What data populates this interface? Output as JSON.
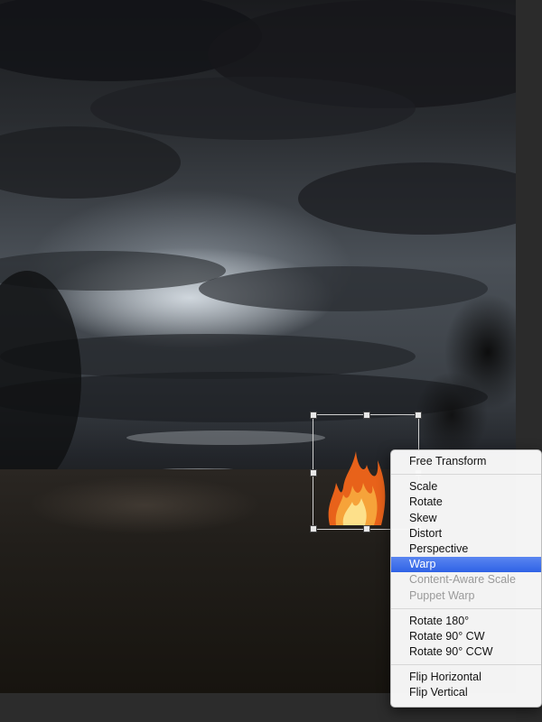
{
  "canvas": {
    "scene": "stormy sky over rocky ground with fire",
    "colors": {
      "sky_dark": "#1a1b1e",
      "sky_light": "#e1e8ee",
      "ground": "#211e1a",
      "fire": "#f08a1c",
      "selection_highlight": "#3b6ee8"
    }
  },
  "transform_box": {
    "handles": [
      "top-left",
      "top-center",
      "top-right",
      "middle-left",
      "middle-right",
      "bottom-left",
      "bottom-center",
      "bottom-right"
    ]
  },
  "context_menu": {
    "groups": [
      {
        "items": [
          {
            "label": "Free Transform",
            "enabled": true
          }
        ]
      },
      {
        "items": [
          {
            "label": "Scale",
            "enabled": true
          },
          {
            "label": "Rotate",
            "enabled": true
          },
          {
            "label": "Skew",
            "enabled": true
          },
          {
            "label": "Distort",
            "enabled": true
          },
          {
            "label": "Perspective",
            "enabled": true
          },
          {
            "label": "Warp",
            "enabled": true,
            "selected": true
          },
          {
            "label": "Content-Aware Scale",
            "enabled": false
          },
          {
            "label": "Puppet Warp",
            "enabled": false
          }
        ]
      },
      {
        "items": [
          {
            "label": "Rotate 180°",
            "enabled": true
          },
          {
            "label": "Rotate 90° CW",
            "enabled": true
          },
          {
            "label": "Rotate 90° CCW",
            "enabled": true
          }
        ]
      },
      {
        "items": [
          {
            "label": "Flip Horizontal",
            "enabled": true
          },
          {
            "label": "Flip Vertical",
            "enabled": true
          }
        ]
      }
    ]
  }
}
